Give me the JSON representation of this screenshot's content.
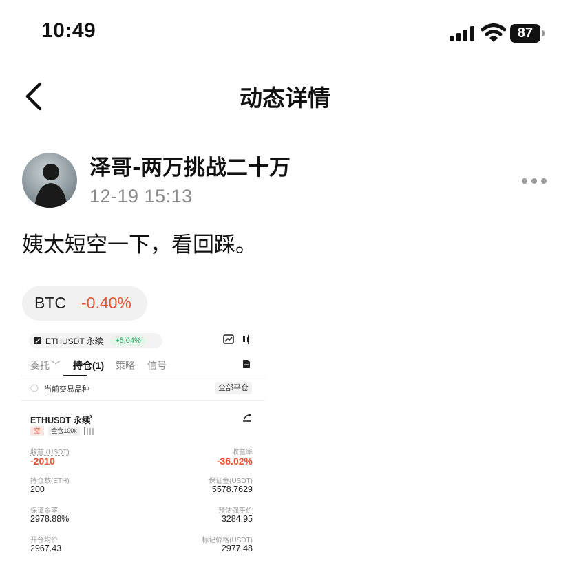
{
  "status_bar": {
    "time": "10:49",
    "battery": "87"
  },
  "nav": {
    "title": "动态详情"
  },
  "post": {
    "author": "泽哥-两万挑战二十万",
    "timestamp": "12-19 15:13",
    "text": "姨太短空一下，看回踩。",
    "ticker": {
      "symbol": "BTC",
      "change": "-0.40%"
    }
  },
  "embedded": {
    "instrument": "ETHUSDT 永续",
    "instrument_change": "+5.04%",
    "tabs": [
      "委托",
      "持仓(1)",
      "策略",
      "信号"
    ],
    "filter_label": "当前交易品种",
    "close_all": "全部平仓",
    "position": {
      "title": "ETHUSDT 永续",
      "side": "空",
      "margin_mode": "全仓100x",
      "pnl_label": "收益 (USDT)",
      "pnl_value": "-2010",
      "roi_label": "收益率",
      "roi_value": "-36.02%",
      "qty_label": "持仓数(ETH)",
      "qty_value": "200",
      "margin_label": "保证金(USDT)",
      "margin_value": "5578.7629",
      "margin_ratio_label": "保证金率",
      "margin_ratio_value": "2978.88%",
      "liq_label": "预估强平价",
      "liq_value": "3284.95",
      "entry_label": "开仓均价",
      "entry_value": "2967.43",
      "mark_label": "标记价格(USDT)",
      "mark_value": "2977.48"
    }
  },
  "colors": {
    "red": "#e8502f",
    "green": "#23a55a"
  }
}
